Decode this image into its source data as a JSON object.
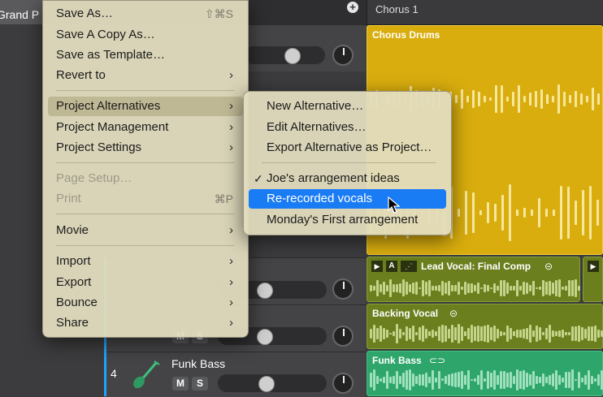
{
  "header": {
    "left_tab": "Grand P",
    "section": "Chorus 1"
  },
  "tracks": {
    "t4_number": "4",
    "t4_name": "Funk Bass",
    "mute_label": "M",
    "solo_label": "S"
  },
  "regions": {
    "chorus_drums": "Chorus Drums",
    "lead_vocal": "Lead Vocal: Final Comp",
    "backing_vocal": "Backing Vocal",
    "funk_bass": "Funk Bass",
    "play_glyph": "▶",
    "auto_glyph": "A"
  },
  "file_menu": {
    "save_as": "Save As…",
    "save_as_shortcut": "⇧⌘S",
    "save_copy": "Save A Copy As…",
    "save_template": "Save as Template…",
    "revert": "Revert to",
    "project_alternatives": "Project Alternatives",
    "project_management": "Project Management",
    "project_settings": "Project Settings",
    "page_setup": "Page Setup…",
    "print": "Print",
    "print_shortcut": "⌘P",
    "movie": "Movie",
    "import": "Import",
    "export": "Export",
    "bounce": "Bounce",
    "share": "Share",
    "arrow": "›"
  },
  "alternatives_menu": {
    "new_alt": "New Alternative…",
    "edit_alt": "Edit Alternatives…",
    "export_alt": "Export Alternative as Project…",
    "alt1": "Joe's arrangement ideas",
    "alt2": "Re-recorded vocals",
    "alt3": "Monday's First arrangement",
    "check": "✓"
  },
  "colors": {
    "drums": "#d9ad0e",
    "vocal": "#6b7f1e",
    "bass": "#2ea56a",
    "highlight": "#1a7cf5"
  }
}
